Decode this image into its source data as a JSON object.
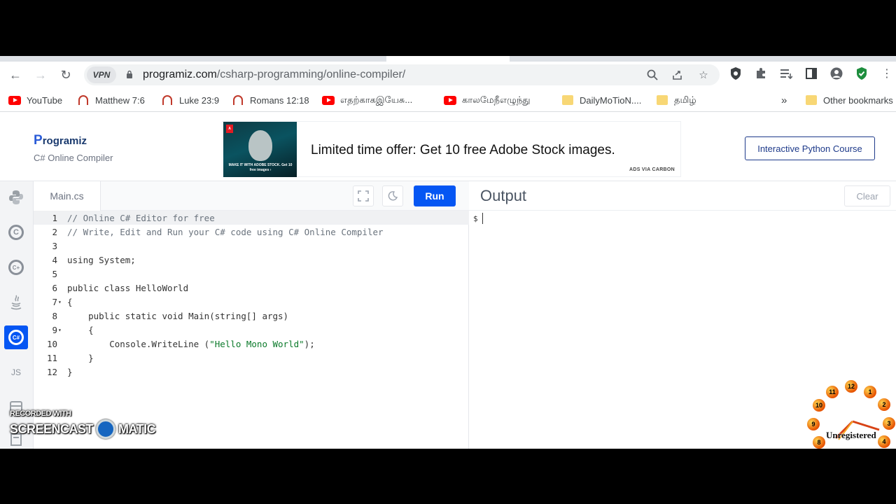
{
  "browser": {
    "vpn_label": "VPN",
    "url_domain": "programiz.com",
    "url_path": "/csharp-programming/online-compiler/"
  },
  "bookmarks": [
    {
      "label": "YouTube",
      "icon": "youtube-icon"
    },
    {
      "label": "Matthew 7:6",
      "icon": "headphones-icon"
    },
    {
      "label": "Luke 23:9",
      "icon": "headphones-icon"
    },
    {
      "label": "Romans 12:18",
      "icon": "headphones-icon"
    },
    {
      "label": "எதற்காகஇயேசு...",
      "icon": "youtube-icon"
    },
    {
      "label": "காலமேநீஎழுந்து",
      "icon": "youtube-icon"
    },
    {
      "label": "DailyMoTioN....",
      "icon": "folder-icon"
    },
    {
      "label": "தமிழ்",
      "icon": "folder-icon"
    }
  ],
  "bookmarks_overflow": "»",
  "other_bookmarks": "Other bookmarks",
  "site": {
    "logo": "rogramiz",
    "logo_initial": "P",
    "subtitle": "C# Online Compiler",
    "ad_text": "Limited time offer: Get 10 free Adobe Stock images.",
    "ad_via": "ADS VIA CARBON",
    "ad_image_caption": "MAKE IT WITH ADOBE STOCK. Get 10 free images ›",
    "course_button": "Interactive Python Course"
  },
  "languages": [
    {
      "name": "python",
      "icon": "python-icon"
    },
    {
      "name": "c",
      "icon": "c-icon"
    },
    {
      "name": "cpp",
      "icon": "cpp-icon"
    },
    {
      "name": "java",
      "icon": "java-icon"
    },
    {
      "name": "csharp",
      "icon": "csharp-icon",
      "active": true
    },
    {
      "name": "js",
      "label": "JS",
      "icon": "js-icon"
    }
  ],
  "editor": {
    "file_tab": "Main.cs",
    "run_label": "Run",
    "lines": [
      {
        "n": "1",
        "text": "// Online C# Editor for free",
        "kind": "comment"
      },
      {
        "n": "2",
        "text": "// Write, Edit and Run your C# code using C# Online Compiler",
        "kind": "comment"
      },
      {
        "n": "3",
        "text": ""
      },
      {
        "n": "4",
        "text": "using System;"
      },
      {
        "n": "5",
        "text": ""
      },
      {
        "n": "6",
        "text": "public class HelloWorld"
      },
      {
        "n": "7",
        "text": "{",
        "fold": true
      },
      {
        "n": "8",
        "text": "    public static void Main(string[] args)"
      },
      {
        "n": "9",
        "text": "    {",
        "fold": true
      },
      {
        "n": "10",
        "text": "        Console.WriteLine (\"Hello Mono World\");",
        "kind": "string"
      },
      {
        "n": "11",
        "text": "    }"
      },
      {
        "n": "12",
        "text": "}"
      }
    ]
  },
  "output": {
    "title": "Output",
    "clear_label": "Clear",
    "prompt": "$"
  },
  "watermark": {
    "small": "RECORDED WITH",
    "left": "SCREENCAST",
    "right": "MATIC",
    "unregistered": "Unregistered"
  },
  "clock_numbers": [
    "12",
    "1",
    "2",
    "3",
    "4",
    "8",
    "9",
    "10",
    "11"
  ]
}
